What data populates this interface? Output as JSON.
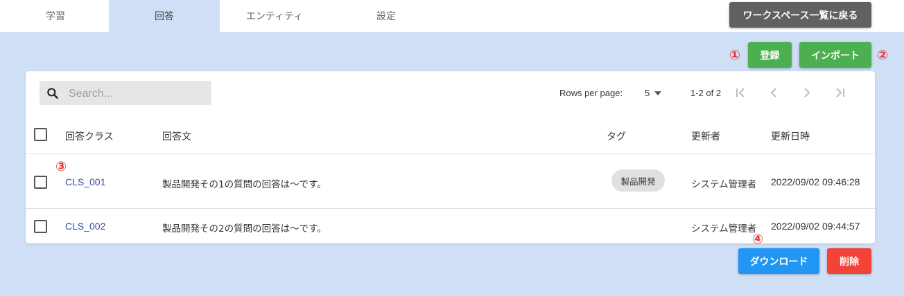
{
  "tabs": [
    {
      "label": "学習",
      "active": false
    },
    {
      "label": "回答",
      "active": true
    },
    {
      "label": "エンティティ",
      "active": false
    },
    {
      "label": "設定",
      "active": false
    }
  ],
  "header": {
    "back_label": "ワークスペース一覧に戻る"
  },
  "actions": {
    "register_label": "登録",
    "import_label": "インポート",
    "download_label": "ダウンロード",
    "delete_label": "削除"
  },
  "markers": {
    "m1": "①",
    "m2": "②",
    "m3": "③",
    "m4": "④"
  },
  "search": {
    "placeholder": "Search...",
    "value": ""
  },
  "pagination": {
    "rows_label": "Rows per page:",
    "rows_value": "5",
    "range": "1-2 of 2"
  },
  "table": {
    "columns": [
      "回答クラス",
      "回答文",
      "タグ",
      "更新者",
      "更新日時"
    ],
    "rows": [
      {
        "class": "CLS_001",
        "text": "製品開発その1の質問の回答は～です。",
        "tag": "製品開発",
        "updater": "システム管理者",
        "updated": "2022/09/02 09:46:28"
      },
      {
        "class": "CLS_002",
        "text": "製品開発その2の質問の回答は～です。",
        "tag": "",
        "updater": "システム管理者",
        "updated": "2022/09/02 09:44:57"
      }
    ]
  },
  "colors": {
    "accent_green": "#4caf50",
    "accent_blue": "#2196f3",
    "danger_red": "#f44336",
    "marker_red": "#e53935",
    "background": "#cfdff5"
  }
}
